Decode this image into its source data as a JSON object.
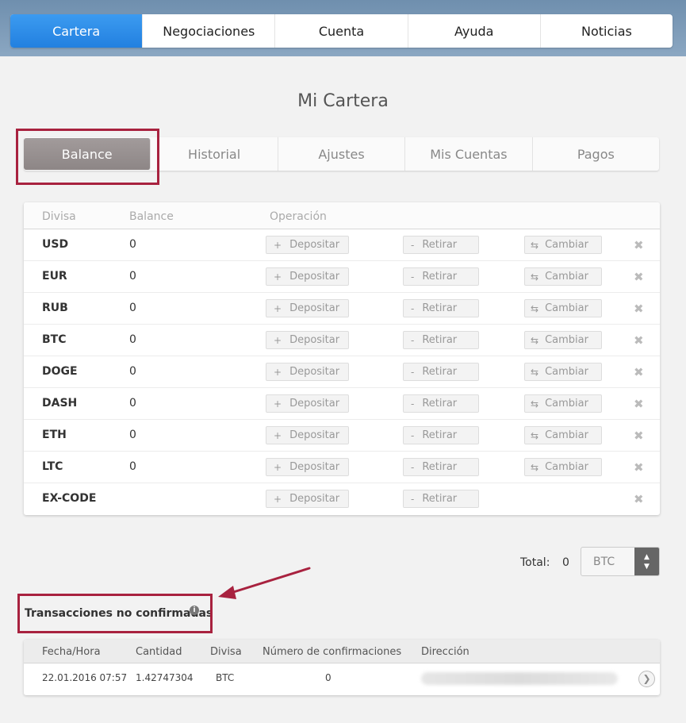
{
  "topnav": {
    "items": [
      {
        "label": "Cartera",
        "active": true
      },
      {
        "label": "Negociaciones",
        "active": false
      },
      {
        "label": "Cuenta",
        "active": false
      },
      {
        "label": "Ayuda",
        "active": false
      },
      {
        "label": "Noticias",
        "active": false
      }
    ]
  },
  "page": {
    "title": "Mi Cartera"
  },
  "subtabs": [
    {
      "label": "Balance",
      "active": true
    },
    {
      "label": "Historial",
      "active": false
    },
    {
      "label": "Ajustes",
      "active": false
    },
    {
      "label": "Mis Cuentas",
      "active": false
    },
    {
      "label": "Pagos",
      "active": false
    }
  ],
  "balance_table": {
    "headers": {
      "currency": "Divisa",
      "balance": "Balance",
      "operation": "Operación"
    },
    "deposit_label": "Depositar",
    "withdraw_label": "Retirar",
    "exchange_label": "Cambiar",
    "rows": [
      {
        "currency": "USD",
        "balance": "0",
        "exchange": true
      },
      {
        "currency": "EUR",
        "balance": "0",
        "exchange": true
      },
      {
        "currency": "RUB",
        "balance": "0",
        "exchange": true
      },
      {
        "currency": "BTC",
        "balance": "0",
        "exchange": true
      },
      {
        "currency": "DOGE",
        "balance": "0",
        "exchange": true
      },
      {
        "currency": "DASH",
        "balance": "0",
        "exchange": true
      },
      {
        "currency": "ETH",
        "balance": "0",
        "exchange": true
      },
      {
        "currency": "LTC",
        "balance": "0",
        "exchange": true
      },
      {
        "currency": "EX-CODE",
        "balance": "",
        "exchange": false
      }
    ]
  },
  "total": {
    "label": "Total:",
    "value": "0",
    "currency": "BTC"
  },
  "unconfirmed": {
    "title": "Transacciones no confirmadas",
    "info_icon": "i",
    "headers": {
      "datetime": "Fecha/Hora",
      "amount": "Cantidad",
      "currency": "Divisa",
      "confirmations": "Número de confirmaciones",
      "address": "Dirección"
    },
    "rows": [
      {
        "datetime": "22.01.2016 07:57",
        "amount": "1.42747304",
        "currency": "BTC",
        "confirmations": "0"
      }
    ]
  },
  "colors": {
    "accent": "#2a88e6",
    "highlight": "#a8223f"
  }
}
